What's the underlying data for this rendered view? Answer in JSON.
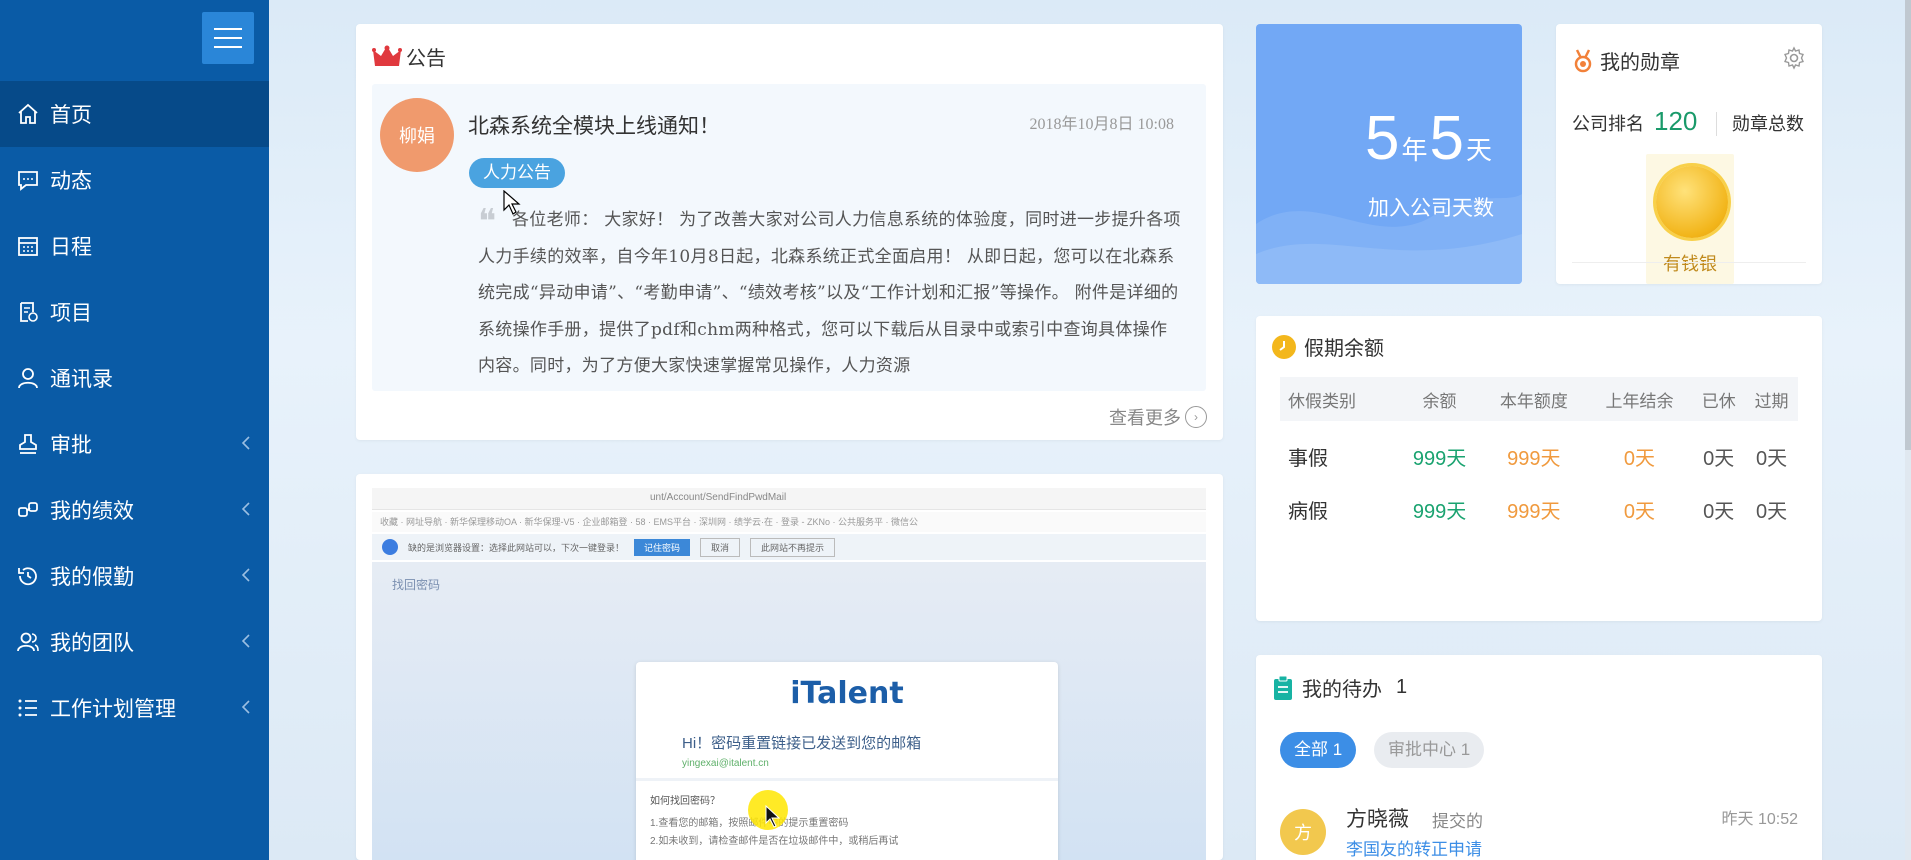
{
  "sidebar": {
    "items": [
      {
        "label": "首页",
        "icon": "home-icon",
        "active": true
      },
      {
        "label": "动态",
        "icon": "message-icon"
      },
      {
        "label": "日程",
        "icon": "calendar-icon"
      },
      {
        "label": "项目",
        "icon": "project-icon"
      },
      {
        "label": "通讯录",
        "icon": "contacts-icon"
      },
      {
        "label": "审批",
        "icon": "approval-icon",
        "expandable": true
      },
      {
        "label": "我的绩效",
        "icon": "performance-icon",
        "expandable": true
      },
      {
        "label": "我的假勤",
        "icon": "attendance-icon",
        "expandable": true
      },
      {
        "label": "我的团队",
        "icon": "team-icon",
        "expandable": true
      },
      {
        "label": "工作计划管理",
        "icon": "plan-icon",
        "expandable": true
      }
    ]
  },
  "notice": {
    "header": "公告",
    "avatar_text": "柳娟",
    "title": "北森系统全模块上线通知！",
    "date": "2018年10月8日  10:08",
    "tag": "人力公告",
    "body": "各位老师：  大家好！  为了改善大家对公司人力信息系统的体验度，同时进一步提升各项人力手续的效率，自今年10月8日起，北森系统正式全面启用！  从即日起，您可以在北森系统完成“异动申请”、“考勤申请”、“绩效考核”以及“工作计划和汇报”等操作。  附件是详细的系统操作手册，提供了pdf和chm两种格式，您可以下载后从目录中或索引中查询具体操作内容。同时，为了方便大家快速掌握常见操作，人力资源",
    "see_more": "查看更多"
  },
  "embedded_screenshot": {
    "url": "unt/Account/SendFindPwdMail",
    "bookmarks": "收藏 · 网址导航 · 新华保理移动OA · 新华保理-V5 · 企业邮箱登 · 58 · EMS平台 · 深圳网 · 绩学云·在 · 登录 - ZKNo · 公共服务平 · 微信公",
    "notice_bar": "缺的是浏览器设置：选择此网站可以，下次一键登录！",
    "notice_btn1": "记住密码",
    "notice_btn2": "取消",
    "notice_btn3": "此网站不再提示",
    "find_password": "找回密码",
    "logo": "iTalent",
    "sent_msg": "Hi！密码重置链接已发送到您的邮箱",
    "email": "yingexai@italent.cn",
    "how_title": "如何找回密码？",
    "line1": "1.查看您的邮箱，按照邮件中的提示重置密码",
    "line2": "2.如未收到，请检查邮件是否在垃圾邮件中，或稍后再试"
  },
  "join_days": {
    "years": "5",
    "year_unit": "年",
    "days": "5",
    "day_unit": "天",
    "label": "加入公司天数"
  },
  "medals": {
    "header": "我的勋章",
    "rank_label": "公司排名",
    "rank_value": "120",
    "total_label": "勋章总数",
    "medal_name": "有钱银"
  },
  "leave": {
    "header": "假期余额",
    "columns": [
      "休假类别",
      "余额",
      "本年额度",
      "上年结余",
      "已休",
      "过期"
    ],
    "rows": [
      [
        "事假",
        "999天",
        "999天",
        "0天",
        "0天",
        "0天"
      ],
      [
        "病假",
        "999天",
        "999天",
        "0天",
        "0天",
        "0天"
      ]
    ]
  },
  "todo": {
    "header": "我的待办",
    "count": "1",
    "tab_all": "全部 1",
    "tab_approval": "审批中心 1",
    "item": {
      "avatar": "方",
      "name": "方晓薇",
      "action": "提交的",
      "desc": "李国友的转正申请",
      "time": "昨天  10:52"
    }
  },
  "colors": {
    "sidebar": "#0a5ba6",
    "sidebar_active": "#064a89",
    "accent": "#3c8ee6",
    "green": "#1aa370",
    "orange": "#f09a3e"
  }
}
